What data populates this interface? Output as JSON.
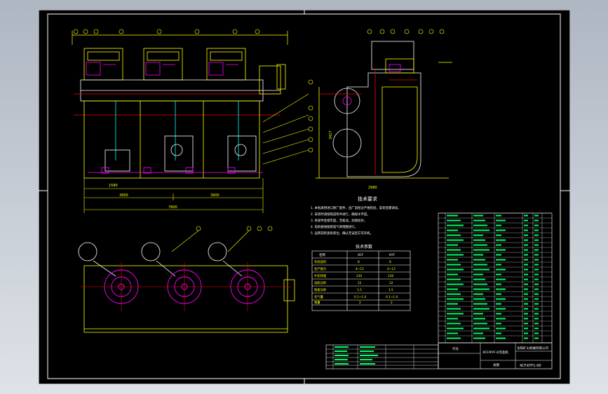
{
  "drawing": {
    "tech_notes_title": "技术要求",
    "notes": [
      "1. 本机采用进口原厂配件，出厂前经过严格检验，安装后需调试。",
      "2. 安装时须按照说明书进行，确保水平度。",
      "3. 各部件连接牢固，无松动，润滑良好。",
      "4. 电机接线按照电气原理图进行。",
      "5. 运转前检查各部位，确认无误后方可开机。"
    ],
    "params_title": "技术参数",
    "params_headers": [
      "名称",
      "XCF",
      "KYF"
    ],
    "params_rows": [
      [
        "有效容积",
        "8",
        "8"
      ],
      [
        "生产能力",
        "4~12",
        "4~12"
      ],
      [
        "叶轮转速",
        "230",
        "230"
      ],
      [
        "电机功率",
        "22",
        "22"
      ],
      [
        "刮板功率",
        "1.5",
        "1.5"
      ],
      [
        "充气量",
        "0.1~1.0",
        "0.1~1.0"
      ],
      [
        "重量",
        "2",
        "2"
      ]
    ],
    "title_block": {
      "company": "沈阳矿山机械有限公司",
      "name": "XCF/KYF-8浮选机",
      "drawing_no": "XCF.KYF1-00",
      "label_a": "总图",
      "label_b": "代号"
    },
    "dimensions": [
      "3900",
      "3900",
      "7800",
      "1580",
      "3417",
      "2980"
    ]
  }
}
